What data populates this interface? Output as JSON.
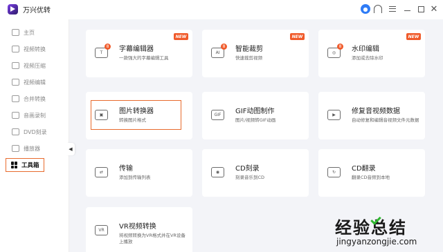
{
  "app": {
    "title": "万兴优转"
  },
  "sidebar": {
    "items": [
      {
        "label": "主页",
        "icon": "home-icon"
      },
      {
        "label": "视频转换",
        "icon": "convert-icon"
      },
      {
        "label": "视频压缩",
        "icon": "compress-icon"
      },
      {
        "label": "视频编辑",
        "icon": "scissors-icon"
      },
      {
        "label": "合并转换",
        "icon": "merge-icon"
      },
      {
        "label": "音画录制",
        "icon": "record-icon"
      },
      {
        "label": "DVD刻录",
        "icon": "dvd-icon"
      },
      {
        "label": "播放器",
        "icon": "player-icon"
      },
      {
        "label": "工具箱",
        "icon": "toolbox-icon",
        "active": true
      }
    ],
    "collapse_glyph": "◀"
  },
  "tools": [
    {
      "title": "字幕编辑器",
      "desc": "一款强大的字幕编辑工具",
      "icon_glyph": "T",
      "badge_new": "NEW",
      "badge_num": "8"
    },
    {
      "title": "智能裁剪",
      "desc": "快速裁剪视频",
      "icon_glyph": "AI",
      "badge_new": "NEW",
      "badge_num": "8"
    },
    {
      "title": "水印编辑",
      "desc": "添加或去除水印",
      "icon_glyph": "◎",
      "badge_new": "NEW",
      "badge_num": "8"
    },
    {
      "title": "图片转换器",
      "desc": "转换图片格式",
      "icon_glyph": "▣"
    },
    {
      "title": "GIF动图制作",
      "desc": "图片/视频转GIF动画",
      "icon_glyph": "GIF"
    },
    {
      "title": "修复音视频数据",
      "desc": "自动修复和编辑音视频文件元数据",
      "icon_glyph": "▶"
    },
    {
      "title": "传输",
      "desc": "添加到传输列表",
      "icon_glyph": "⇄"
    },
    {
      "title": "CD刻录",
      "desc": "刻录音乐到CD",
      "icon_glyph": "◉"
    },
    {
      "title": "CD翻录",
      "desc": "翻录CD音频到本地",
      "icon_glyph": "↻"
    },
    {
      "title": "VR视频转换",
      "desc": "将视频转换为VR格式并在VR设备上播放",
      "icon_glyph": "VR"
    }
  ],
  "watermark": {
    "main": "经验总结",
    "sub": "jingyanzongjie.com"
  },
  "colors": {
    "accent": "#e86a2c",
    "badge": "#f05a2a",
    "user": "#2f7cf6"
  }
}
